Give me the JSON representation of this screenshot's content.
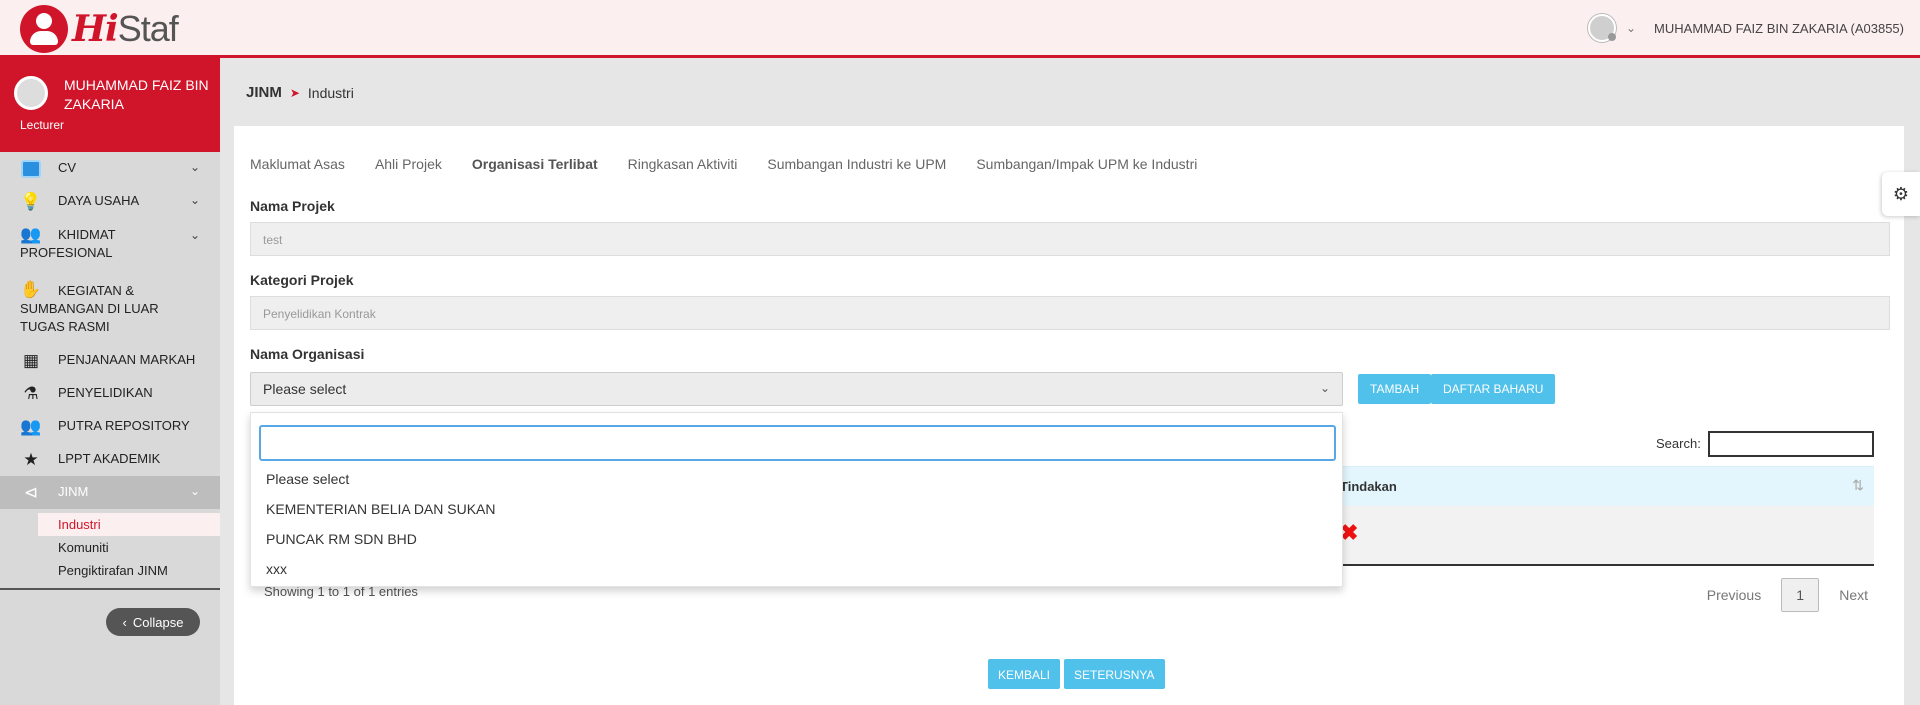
{
  "app": {
    "logo_hi": "Hi",
    "logo_staf": "Staf",
    "user_name": "MUHAMMAD FAIZ BIN ZAKARIA (A03855)"
  },
  "sidebar": {
    "profile_name": "MUHAMMAD FAIZ BIN ZAKARIA",
    "profile_role": "Lecturer",
    "items": [
      {
        "label": "CV",
        "icon": "cv-icon"
      },
      {
        "label": "DAYA USAHA",
        "icon": "lightbulb-icon"
      },
      {
        "label": "KHIDMAT PROFESIONAL",
        "icon": "users-icon"
      },
      {
        "label": "KEGIATAN & SUMBANGAN DI LUAR TUGAS RASMI",
        "icon": "hand-icon"
      },
      {
        "label": "PENJANAAN MARKAH",
        "icon": "calculator-icon"
      },
      {
        "label": "PENYELIDIKAN",
        "icon": "flask-icon"
      },
      {
        "label": "PUTRA REPOSITORY",
        "icon": "users-icon"
      },
      {
        "label": "LPPT AKADEMIK",
        "icon": "star-icon"
      },
      {
        "label": "JINM",
        "icon": "share-icon"
      }
    ],
    "sub_items": [
      "Industri",
      "Komuniti",
      "Pengiktirafan JINM"
    ],
    "collapse_label": "Collapse"
  },
  "breadcrumb": {
    "root": "JINM",
    "current": "Industri"
  },
  "tabs": [
    "Maklumat Asas",
    "Ahli Projek",
    "Organisasi Terlibat",
    "Ringkasan Aktiviti",
    "Sumbangan Industri ke UPM",
    "Sumbangan/Impak UPM ke Industri"
  ],
  "active_tab": "Organisasi Terlibat",
  "form": {
    "nama_projek_label": "Nama Projek",
    "nama_projek_value": "test",
    "kategori_label": "Kategori Projek",
    "kategori_value": "Penyelidikan Kontrak",
    "organisasi_label": "Nama Organisasi",
    "organisasi_selected": "Please select",
    "tambah_label": "TAMBAH",
    "daftar_label": "DAFTAR BAHARU"
  },
  "dropdown": {
    "search_value": "",
    "options": [
      "Please select",
      "KEMENTERIAN BELIA DAN SUKAN",
      "PUNCAK RM SDN BHD",
      "xxx"
    ]
  },
  "table": {
    "search_label": "Search:",
    "col_tindakan": "Tindakan",
    "info": "Showing 1 to 1 of 1 entries",
    "prev": "Previous",
    "page": "1",
    "next": "Next"
  },
  "footer": {
    "kembali": "KEMBALI",
    "seterusnya": "SETERUSNYA"
  },
  "colors": {
    "brand_red": "#d0152b",
    "accent_blue": "#4fc1ea"
  }
}
